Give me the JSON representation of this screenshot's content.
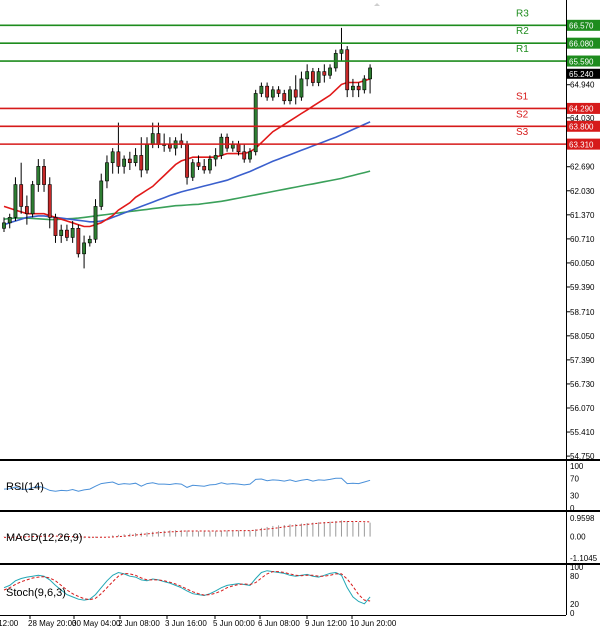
{
  "chart_data": {
    "type": "candlestick",
    "colors": {
      "up_candle": "#2e7d32",
      "down_candle": "#c62828",
      "ma_fast": "#e11919",
      "ma_mid": "#3a5fcd",
      "ma_slow": "#3aa05a",
      "resistance": "#1e8c1e",
      "support": "#d61a1a",
      "rsi_line": "#4a90d9",
      "macd_hist": "#9a9a9a",
      "macd_signal": "#d61a1a",
      "stoch_main": "#22a7b5",
      "stoch_signal": "#d61a1a",
      "grid_separator": "#000000"
    },
    "price_axis": {
      "min": 54.78,
      "max": 67.1,
      "ticks": [
        "66.570",
        "66.080",
        "65.590",
        "64.940",
        "64.290",
        "64.030",
        "63.800",
        "63.310",
        "62.690",
        "62.030",
        "61.370",
        "60.710",
        "60.050",
        "59.390",
        "58.710",
        "58.050",
        "57.390",
        "56.730",
        "56.070",
        "55.410",
        "54.750"
      ],
      "last_price_label": "65.240"
    },
    "levels": [
      {
        "name": "R3",
        "value": 66.57,
        "kind": "resistance"
      },
      {
        "name": "R2",
        "value": 66.08,
        "kind": "resistance"
      },
      {
        "name": "R1",
        "value": 65.59,
        "kind": "resistance"
      },
      {
        "name": "S1",
        "value": 64.29,
        "kind": "support"
      },
      {
        "name": "S2",
        "value": 63.8,
        "kind": "support"
      },
      {
        "name": "S3",
        "value": 63.31,
        "kind": "support"
      }
    ],
    "time_labels": [
      "y 12:00",
      "28 May 20:00",
      "30 May 04:00",
      "2 Jun 08:00",
      "3 Jun 16:00",
      "5 Jun 00:00",
      "6 Jun 08:00",
      "9 Jun 12:00",
      "10 Jun 20:00"
    ],
    "candles": [
      {
        "o": 61.0,
        "h": 61.3,
        "l": 60.9,
        "c": 61.15
      },
      {
        "o": 61.15,
        "h": 61.4,
        "l": 61.0,
        "c": 61.3
      },
      {
        "o": 61.3,
        "h": 62.4,
        "l": 61.2,
        "c": 62.2
      },
      {
        "o": 62.2,
        "h": 62.8,
        "l": 61.4,
        "c": 61.6
      },
      {
        "o": 61.6,
        "h": 61.9,
        "l": 61.1,
        "c": 61.4
      },
      {
        "o": 61.4,
        "h": 62.3,
        "l": 61.3,
        "c": 62.2
      },
      {
        "o": 62.2,
        "h": 62.9,
        "l": 62.0,
        "c": 62.7
      },
      {
        "o": 62.7,
        "h": 62.9,
        "l": 62.0,
        "c": 62.2
      },
      {
        "o": 62.2,
        "h": 62.4,
        "l": 61.0,
        "c": 61.3
      },
      {
        "o": 61.3,
        "h": 61.4,
        "l": 60.6,
        "c": 60.8
      },
      {
        "o": 60.8,
        "h": 61.1,
        "l": 60.6,
        "c": 60.95
      },
      {
        "o": 60.95,
        "h": 61.1,
        "l": 60.65,
        "c": 60.75
      },
      {
        "o": 60.75,
        "h": 61.2,
        "l": 60.6,
        "c": 61.0
      },
      {
        "o": 61.0,
        "h": 61.1,
        "l": 60.2,
        "c": 60.3
      },
      {
        "o": 60.3,
        "h": 60.8,
        "l": 59.9,
        "c": 60.6
      },
      {
        "o": 60.6,
        "h": 60.8,
        "l": 60.5,
        "c": 60.7
      },
      {
        "o": 60.7,
        "h": 61.8,
        "l": 60.6,
        "c": 61.6
      },
      {
        "o": 61.6,
        "h": 62.5,
        "l": 61.5,
        "c": 62.3
      },
      {
        "o": 62.3,
        "h": 63.0,
        "l": 62.1,
        "c": 62.8
      },
      {
        "o": 62.8,
        "h": 63.2,
        "l": 62.5,
        "c": 63.1
      },
      {
        "o": 63.1,
        "h": 63.9,
        "l": 62.5,
        "c": 62.7
      },
      {
        "o": 62.7,
        "h": 63.0,
        "l": 62.5,
        "c": 62.9
      },
      {
        "o": 62.9,
        "h": 63.1,
        "l": 62.6,
        "c": 62.8
      },
      {
        "o": 62.8,
        "h": 63.2,
        "l": 62.7,
        "c": 63.0
      },
      {
        "o": 63.0,
        "h": 63.5,
        "l": 62.4,
        "c": 62.6
      },
      {
        "o": 62.6,
        "h": 63.5,
        "l": 62.5,
        "c": 63.3
      },
      {
        "o": 63.3,
        "h": 63.9,
        "l": 63.2,
        "c": 63.6
      },
      {
        "o": 63.6,
        "h": 63.9,
        "l": 63.2,
        "c": 63.3
      },
      {
        "o": 63.3,
        "h": 63.6,
        "l": 63.1,
        "c": 63.3
      },
      {
        "o": 63.3,
        "h": 63.5,
        "l": 63.1,
        "c": 63.2
      },
      {
        "o": 63.2,
        "h": 63.5,
        "l": 63.0,
        "c": 63.4
      },
      {
        "o": 63.4,
        "h": 63.6,
        "l": 63.2,
        "c": 63.3
      },
      {
        "o": 63.3,
        "h": 63.4,
        "l": 62.2,
        "c": 62.4
      },
      {
        "o": 62.4,
        "h": 62.9,
        "l": 62.3,
        "c": 62.8
      },
      {
        "o": 62.8,
        "h": 63.0,
        "l": 62.6,
        "c": 62.7
      },
      {
        "o": 62.7,
        "h": 62.9,
        "l": 62.5,
        "c": 62.6
      },
      {
        "o": 62.6,
        "h": 63.0,
        "l": 62.5,
        "c": 62.9
      },
      {
        "o": 62.9,
        "h": 63.2,
        "l": 62.7,
        "c": 63.0
      },
      {
        "o": 63.0,
        "h": 63.6,
        "l": 62.9,
        "c": 63.5
      },
      {
        "o": 63.5,
        "h": 63.6,
        "l": 63.1,
        "c": 63.2
      },
      {
        "o": 63.2,
        "h": 63.4,
        "l": 63.1,
        "c": 63.3
      },
      {
        "o": 63.3,
        "h": 63.4,
        "l": 63.0,
        "c": 63.1
      },
      {
        "o": 63.1,
        "h": 63.3,
        "l": 62.8,
        "c": 62.9
      },
      {
        "o": 62.9,
        "h": 63.2,
        "l": 62.8,
        "c": 63.1
      },
      {
        "o": 63.1,
        "h": 64.8,
        "l": 63.0,
        "c": 64.7
      },
      {
        "o": 64.7,
        "h": 65.0,
        "l": 64.6,
        "c": 64.9
      },
      {
        "o": 64.9,
        "h": 65.0,
        "l": 64.5,
        "c": 64.6
      },
      {
        "o": 64.6,
        "h": 64.9,
        "l": 64.5,
        "c": 64.8
      },
      {
        "o": 64.8,
        "h": 64.9,
        "l": 64.6,
        "c": 64.7
      },
      {
        "o": 64.7,
        "h": 64.8,
        "l": 64.4,
        "c": 64.5
      },
      {
        "o": 64.5,
        "h": 64.9,
        "l": 64.4,
        "c": 64.8
      },
      {
        "o": 64.8,
        "h": 65.2,
        "l": 64.4,
        "c": 64.6
      },
      {
        "o": 64.6,
        "h": 65.3,
        "l": 64.5,
        "c": 65.1
      },
      {
        "o": 65.1,
        "h": 65.5,
        "l": 64.9,
        "c": 65.3
      },
      {
        "o": 65.3,
        "h": 65.4,
        "l": 64.9,
        "c": 65.0
      },
      {
        "o": 65.0,
        "h": 65.4,
        "l": 64.9,
        "c": 65.3
      },
      {
        "o": 65.3,
        "h": 65.5,
        "l": 65.0,
        "c": 65.2
      },
      {
        "o": 65.2,
        "h": 65.5,
        "l": 65.1,
        "c": 65.4
      },
      {
        "o": 65.4,
        "h": 65.9,
        "l": 65.3,
        "c": 65.8
      },
      {
        "o": 65.8,
        "h": 66.5,
        "l": 65.6,
        "c": 65.9
      },
      {
        "o": 65.9,
        "h": 66.0,
        "l": 64.6,
        "c": 64.8
      },
      {
        "o": 64.8,
        "h": 65.1,
        "l": 64.6,
        "c": 64.9
      },
      {
        "o": 64.9,
        "h": 65.0,
        "l": 64.6,
        "c": 64.8
      },
      {
        "o": 64.8,
        "h": 65.2,
        "l": 64.7,
        "c": 65.1
      },
      {
        "o": 65.1,
        "h": 65.5,
        "l": 64.7,
        "c": 65.4
      }
    ],
    "ma_fast": [
      61.6,
      61.55,
      61.5,
      61.45,
      61.4,
      61.4,
      61.4,
      61.4,
      61.35,
      61.3,
      61.25,
      61.2,
      61.15,
      61.1,
      61.05,
      61.05,
      61.1,
      61.15,
      61.25,
      61.35,
      61.5,
      61.6,
      61.7,
      61.85,
      61.95,
      62.05,
      62.15,
      62.3,
      62.45,
      62.6,
      62.75,
      62.85,
      62.9,
      62.95,
      62.95,
      62.95,
      62.95,
      62.95,
      63.0,
      63.05,
      63.05,
      63.05,
      63.05,
      63.1,
      63.2,
      63.35,
      63.5,
      63.65,
      63.75,
      63.85,
      63.95,
      64.05,
      64.15,
      64.25,
      64.35,
      64.45,
      64.55,
      64.65,
      64.8,
      64.95,
      65.0,
      65.0,
      65.0,
      65.05,
      65.1
    ],
    "ma_mid": [
      61.1,
      61.15,
      61.2,
      61.25,
      61.3,
      61.32,
      61.34,
      61.34,
      61.32,
      61.3,
      61.28,
      61.26,
      61.24,
      61.22,
      61.2,
      61.18,
      61.18,
      61.2,
      61.24,
      61.3,
      61.36,
      61.42,
      61.48,
      61.54,
      61.6,
      61.66,
      61.72,
      61.78,
      61.84,
      61.9,
      61.95,
      62.0,
      62.04,
      62.08,
      62.12,
      62.16,
      62.2,
      62.24,
      62.28,
      62.32,
      62.38,
      62.44,
      62.5,
      62.56,
      62.63,
      62.7,
      62.77,
      62.84,
      62.9,
      62.96,
      63.02,
      63.08,
      63.14,
      63.2,
      63.26,
      63.32,
      63.38,
      63.44,
      63.5,
      63.57,
      63.64,
      63.71,
      63.78,
      63.85,
      63.92
    ],
    "ma_slow": [
      61.25,
      61.27,
      61.28,
      61.28,
      61.28,
      61.27,
      61.26,
      61.25,
      61.24,
      61.24,
      61.25,
      61.26,
      61.27,
      61.28,
      61.3,
      61.32,
      61.34,
      61.36,
      61.38,
      61.4,
      61.42,
      61.44,
      61.46,
      61.48,
      61.5,
      61.52,
      61.54,
      61.56,
      61.58,
      61.6,
      61.62,
      61.63,
      61.64,
      61.65,
      61.66,
      61.68,
      61.7,
      61.72,
      61.74,
      61.77,
      61.8,
      61.83,
      61.86,
      61.89,
      61.92,
      61.95,
      61.98,
      62.01,
      62.04,
      62.07,
      62.1,
      62.13,
      62.16,
      62.19,
      62.22,
      62.25,
      62.28,
      62.31,
      62.34,
      62.37,
      62.41,
      62.45,
      62.49,
      62.53,
      62.57
    ],
    "rsi": {
      "label": "RSI(14)",
      "axis_ticks": [
        "100",
        "70",
        "30",
        "0"
      ],
      "values": [
        45,
        46,
        50,
        45,
        44,
        48,
        52,
        48,
        42,
        40,
        42,
        41,
        44,
        40,
        43,
        45,
        52,
        58,
        60,
        62,
        56,
        58,
        57,
        59,
        52,
        58,
        60,
        57,
        57,
        56,
        58,
        57,
        49,
        54,
        53,
        52,
        55,
        56,
        60,
        57,
        58,
        57,
        55,
        57,
        68,
        69,
        65,
        67,
        66,
        64,
        67,
        63,
        66,
        68,
        64,
        67,
        66,
        68,
        71,
        71,
        58,
        59,
        58,
        62,
        66
      ]
    },
    "macd": {
      "label": "MACD(12,26,9)",
      "axis_ticks": [
        "0.9598",
        "0.00",
        "-1.1045"
      ],
      "histogram": [
        -0.02,
        -0.01,
        0.01,
        0.03,
        0.03,
        0.04,
        0.06,
        0.06,
        0.04,
        0.01,
        -0.02,
        -0.04,
        -0.05,
        -0.07,
        -0.08,
        -0.08,
        -0.06,
        -0.03,
        0.01,
        0.06,
        0.09,
        0.12,
        0.15,
        0.18,
        0.2,
        0.22,
        0.25,
        0.28,
        0.3,
        0.32,
        0.33,
        0.33,
        0.31,
        0.3,
        0.28,
        0.27,
        0.27,
        0.28,
        0.3,
        0.31,
        0.32,
        0.32,
        0.31,
        0.31,
        0.38,
        0.45,
        0.5,
        0.55,
        0.58,
        0.6,
        0.63,
        0.65,
        0.67,
        0.7,
        0.72,
        0.74,
        0.75,
        0.77,
        0.8,
        0.83,
        0.8,
        0.77,
        0.74,
        0.72,
        0.72
      ],
      "signal": [
        -0.04,
        -0.035,
        -0.03,
        -0.02,
        -0.01,
        0.0,
        0.01,
        0.02,
        0.025,
        0.025,
        0.02,
        0.01,
        0.0,
        -0.01,
        -0.02,
        -0.03,
        -0.035,
        -0.035,
        -0.03,
        -0.02,
        0.0,
        0.02,
        0.05,
        0.08,
        0.11,
        0.14,
        0.17,
        0.2,
        0.22,
        0.24,
        0.26,
        0.28,
        0.29,
        0.29,
        0.29,
        0.29,
        0.29,
        0.29,
        0.29,
        0.3,
        0.3,
        0.31,
        0.31,
        0.31,
        0.33,
        0.36,
        0.39,
        0.42,
        0.46,
        0.5,
        0.54,
        0.57,
        0.6,
        0.63,
        0.66,
        0.69,
        0.71,
        0.73,
        0.75,
        0.77,
        0.78,
        0.78,
        0.78,
        0.77,
        0.76
      ]
    },
    "stoch": {
      "label": "Stoch(9,6,3)",
      "axis_ticks": [
        "100",
        "80",
        "20",
        "0"
      ],
      "main": [
        55,
        60,
        70,
        75,
        78,
        80,
        82,
        80,
        72,
        60,
        50,
        40,
        35,
        30,
        28,
        30,
        40,
        55,
        70,
        82,
        88,
        85,
        80,
        78,
        72,
        70,
        74,
        72,
        68,
        65,
        60,
        55,
        48,
        42,
        40,
        38,
        42,
        48,
        55,
        60,
        62,
        64,
        62,
        60,
        75,
        88,
        92,
        90,
        88,
        86,
        82,
        80,
        82,
        84,
        80,
        78,
        82,
        86,
        88,
        82,
        55,
        35,
        25,
        20,
        35
      ],
      "signal": [
        50,
        55,
        62,
        68,
        72,
        76,
        78,
        79,
        76,
        70,
        60,
        50,
        42,
        36,
        31,
        29,
        32,
        42,
        55,
        68,
        80,
        86,
        85,
        82,
        76,
        72,
        72,
        72,
        70,
        67,
        63,
        58,
        52,
        46,
        42,
        39,
        40,
        43,
        48,
        55,
        59,
        62,
        63,
        62,
        66,
        76,
        85,
        90,
        90,
        88,
        85,
        82,
        81,
        82,
        82,
        80,
        80,
        82,
        85,
        85,
        74,
        58,
        40,
        28,
        26
      ]
    }
  }
}
